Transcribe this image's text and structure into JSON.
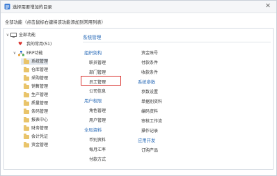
{
  "window": {
    "title": "选择需要增加的目录",
    "close_label": "✕"
  },
  "subtitle": "全部功能（点击鼠标右键将该功能添加到常用列表）",
  "tree": [
    {
      "label": "全部功能",
      "icon": "monitor-icon",
      "caret": "∨"
    },
    {
      "label": "我的常用(51)",
      "icon": "heart-icon"
    },
    {
      "label": "ERP功能",
      "icon": "org-icon",
      "caret": "∨"
    },
    {
      "label": "系统管理",
      "icon": "folder-icon",
      "selected": true
    },
    {
      "label": "仓库管理",
      "icon": "folder-icon"
    },
    {
      "label": "采购管理",
      "icon": "folder-icon"
    },
    {
      "label": "销售管理",
      "icon": "folder-icon"
    },
    {
      "label": "生产管理",
      "icon": "folder-icon"
    },
    {
      "label": "质量管理",
      "icon": "folder-icon"
    },
    {
      "label": "条码管理",
      "icon": "folder-icon"
    },
    {
      "label": "报表中心",
      "icon": "folder-icon"
    },
    {
      "label": "财务管理",
      "icon": "folder-icon"
    },
    {
      "label": "会计凭证",
      "icon": "folder-icon"
    },
    {
      "label": "资金管理",
      "icon": "folder-icon"
    }
  ],
  "content": {
    "category_title": "系统管理",
    "col1": {
      "sections": [
        {
          "title": "组织架构",
          "items": [
            "职员管理",
            "部门管理",
            "员工管理",
            "公司信息"
          ]
        },
        {
          "title": "用户权限",
          "items": [
            "角色管理",
            "用户管理"
          ]
        },
        {
          "title": "全局资料",
          "items": [
            "币别资料",
            "每月汇率",
            "付款方式"
          ]
        }
      ]
    },
    "col2": {
      "top_items": [
        "资金账号",
        "付款条件",
        "收款条件"
      ],
      "sections": [
        {
          "title": "系统参数",
          "items": [
            "参数设置",
            "单据别资料",
            "编码资料",
            "审核工作流",
            "操作记录"
          ]
        },
        {
          "title": "应用开发",
          "items": [
            "订购产品"
          ]
        }
      ]
    },
    "highlighted_item": "员工管理",
    "colors": {
      "accent": "#2b6cb8",
      "highlight": "#d9332f"
    }
  }
}
